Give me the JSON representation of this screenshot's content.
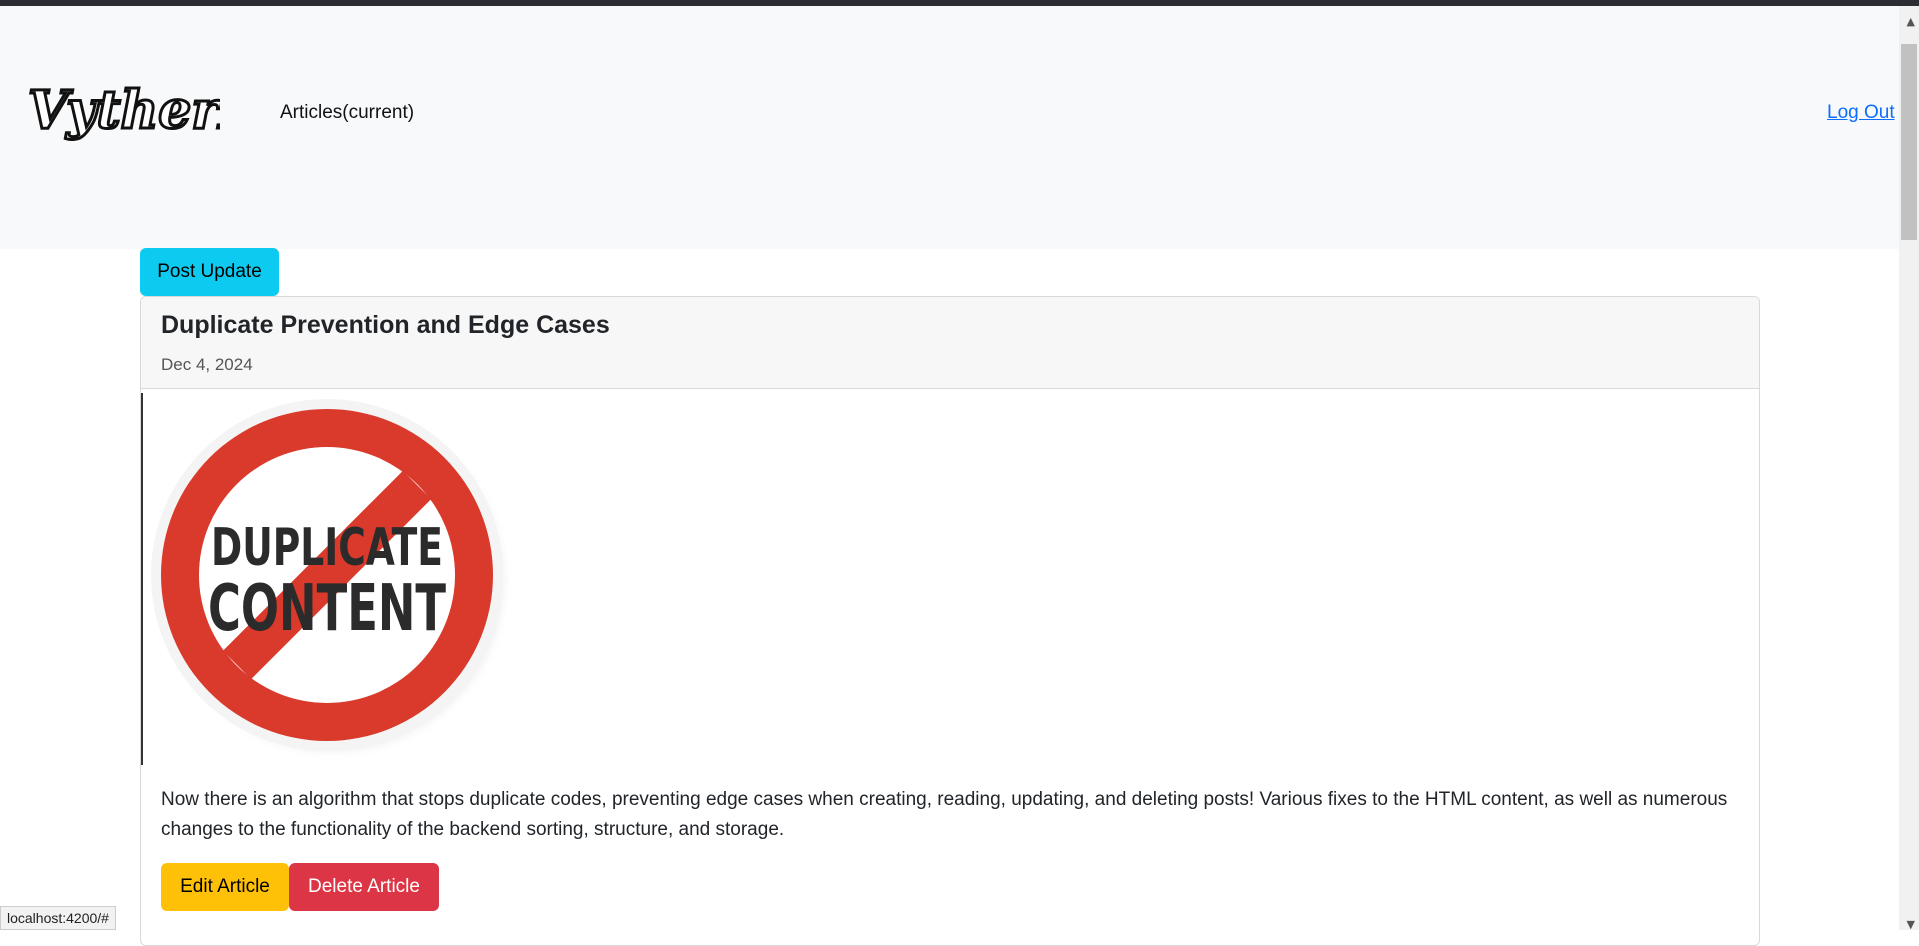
{
  "navbar": {
    "logo_text": "VytherN",
    "nav_link": "Articles(current)",
    "logout": "Log Out"
  },
  "actions": {
    "post_update": "Post Update"
  },
  "article": {
    "title": "Duplicate Prevention and Edge Cases",
    "date": "Dec 4, 2024",
    "image": {
      "line1": "DUPLICATE",
      "line2": "CONTENT"
    },
    "body": "Now there is an algorithm that stops duplicate codes, preventing edge cases when creating, reading, updating, and deleting posts! Various fixes to the HTML content, as well as numerous changes to the functionality of the backend sorting, structure, and storage.",
    "edit_label": "Edit Article",
    "delete_label": "Delete Article"
  },
  "status_bar": {
    "url": "localhost:4200/#"
  },
  "colors": {
    "info": "#0dcaf0",
    "warning": "#ffc107",
    "danger": "#dc3545",
    "link": "#0d6efd"
  }
}
